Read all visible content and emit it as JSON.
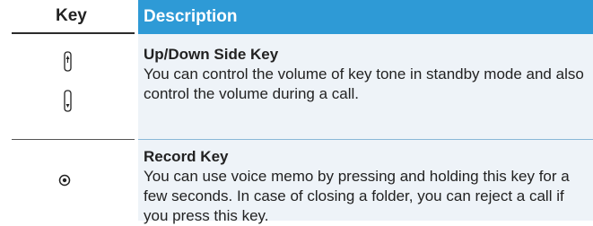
{
  "table": {
    "header": {
      "key": "Key",
      "description": "Description"
    },
    "rows": [
      {
        "key_icon": "up-down-side-key-icon",
        "title": "Up/Down Side Key",
        "text": "You can control the volume of key tone in standby mode and also control the volume during a call."
      },
      {
        "key_icon": "record-key-icon",
        "title": "Record Key",
        "text": "You can use voice memo by pressing and holding this key for a few seconds. In case of closing a folder, you can reject a call if you press this key."
      }
    ]
  },
  "colors": {
    "header_bg": "#2e9ad6",
    "row_bg": "#eef3f8",
    "header_text": "#ffffff"
  }
}
